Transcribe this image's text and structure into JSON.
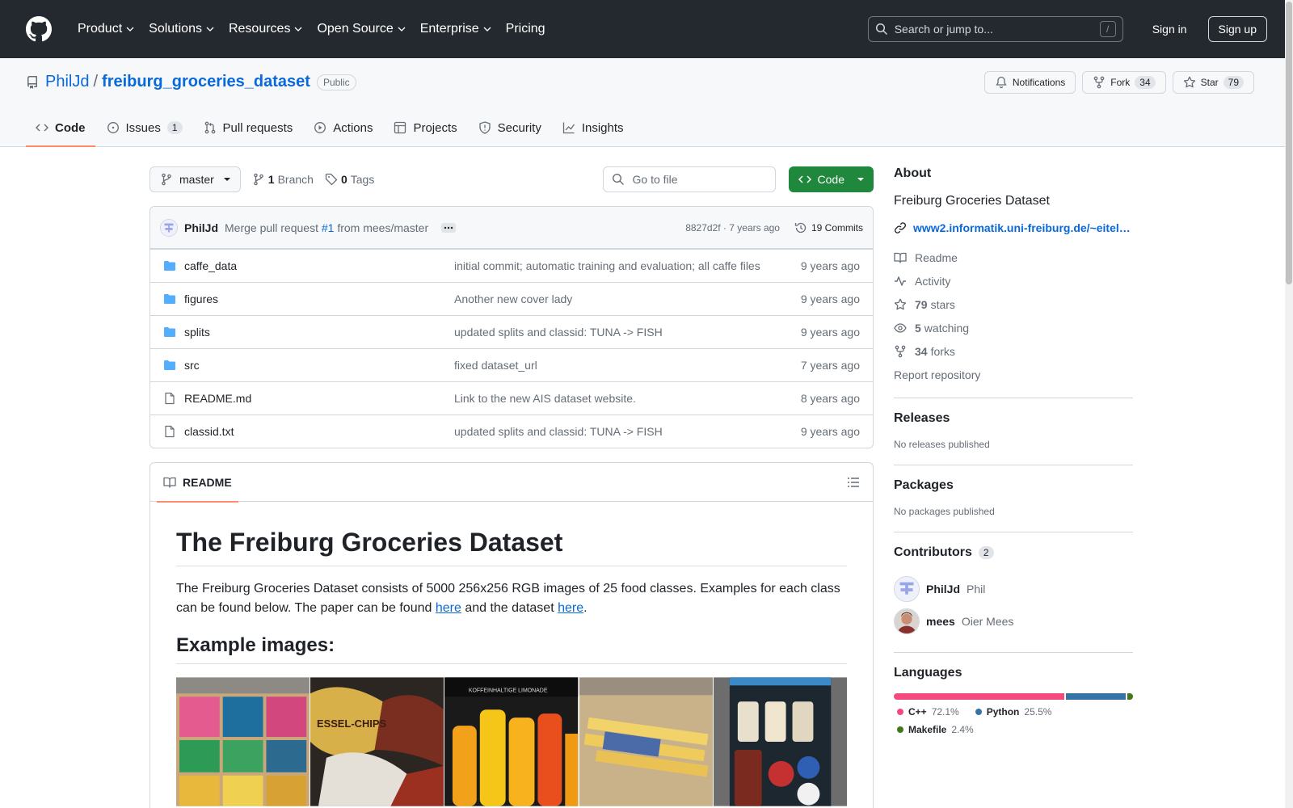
{
  "header": {
    "nav": [
      "Product",
      "Solutions",
      "Resources",
      "Open Source",
      "Enterprise",
      "Pricing"
    ],
    "search_placeholder": "Search or jump to...",
    "search_shortcut": "/",
    "sign_in": "Sign in",
    "sign_up": "Sign up"
  },
  "repo": {
    "owner": "PhilJd",
    "separator": "/",
    "name": "freiburg_groceries_dataset",
    "visibility": "Public",
    "notifications": "Notifications",
    "fork_label": "Fork",
    "fork_count": "34",
    "star_label": "Star",
    "star_count": "79"
  },
  "tabs": [
    {
      "label": "Code",
      "icon": "code-icon"
    },
    {
      "label": "Issues",
      "count": "1",
      "icon": "issue-icon"
    },
    {
      "label": "Pull requests",
      "icon": "pull-request-icon"
    },
    {
      "label": "Actions",
      "icon": "play-icon"
    },
    {
      "label": "Projects",
      "icon": "table-icon"
    },
    {
      "label": "Security",
      "icon": "shield-icon"
    },
    {
      "label": "Insights",
      "icon": "graph-icon"
    }
  ],
  "filenav": {
    "branch": "master",
    "branch_count": "1",
    "branch_label": "Branch",
    "tag_count": "0",
    "tag_label": "Tags",
    "goto_placeholder": "Go to file",
    "code_button": "Code"
  },
  "commit": {
    "author": "PhilJd",
    "message_pre": "Merge pull request",
    "pr_link": "#1",
    "message_post": "from mees/master",
    "sha": "8827d2f",
    "age": "· 7 years ago",
    "commits": "19 Commits"
  },
  "files": [
    {
      "name": "caffe_data",
      "type": "folder",
      "message": "initial commit; automatic training and evaluation; all caffe files",
      "age": "9 years ago"
    },
    {
      "name": "figures",
      "type": "folder",
      "message": "Another new cover lady",
      "age": "9 years ago"
    },
    {
      "name": "splits",
      "type": "folder",
      "message": "updated splits and classid: TUNA -> FISH",
      "age": "9 years ago"
    },
    {
      "name": "src",
      "type": "folder",
      "message": "fixed dataset_url",
      "age": "7 years ago"
    },
    {
      "name": "README.md",
      "type": "file",
      "message": "Link to the new AIS dataset website.",
      "age": "8 years ago"
    },
    {
      "name": "classid.txt",
      "type": "file",
      "message": "updated splits and classid: TUNA -> FISH",
      "age": "9 years ago"
    }
  ],
  "readme": {
    "tab": "README",
    "title": "The Freiburg Groceries Dataset",
    "para_1": "The Freiburg Groceries Dataset consists of 5000 256x256 RGB images of 25 food classes. Examples for each class can be found below. The paper can be found ",
    "link_1": "here",
    "para_2": " and the dataset ",
    "link_2": "here",
    "para_3": ".",
    "examples_heading": "Example images:",
    "thumb_text_2": "ESSEL-CHIPS",
    "thumb_text_3": "KOFFEINHALTIGE LIMONADE"
  },
  "sidebar": {
    "about": "About",
    "description": "Freiburg Groceries Dataset",
    "website": "www2.informatik.uni-freiburg.de/~eitel…",
    "readme": "Readme",
    "activity": "Activity",
    "stars_count": "79",
    "stars_label": "stars",
    "watching_count": "5",
    "watching_label": "watching",
    "forks_count": "34",
    "forks_label": "forks",
    "report": "Report repository",
    "releases": "Releases",
    "releases_none": "No releases published",
    "packages": "Packages",
    "packages_none": "No packages published",
    "contributors": "Contributors",
    "contributors_count": "2",
    "contributor_list": [
      {
        "login": "PhilJd",
        "name": "Phil"
      },
      {
        "login": "mees",
        "name": "Oier Mees"
      }
    ],
    "languages": "Languages",
    "language_list": [
      {
        "name": "C++",
        "pct": "72.1%",
        "value": 72.1,
        "color": "#f34b7d"
      },
      {
        "name": "Python",
        "pct": "25.5%",
        "value": 25.5,
        "color": "#3572A5"
      },
      {
        "name": "Makefile",
        "pct": "2.4%",
        "value": 2.4,
        "color": "#427819"
      }
    ]
  }
}
